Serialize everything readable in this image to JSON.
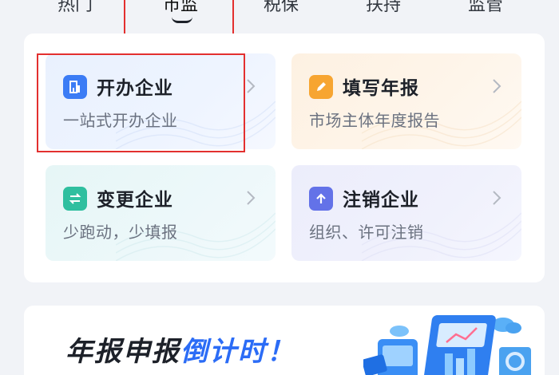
{
  "tabs": [
    {
      "label": "热门"
    },
    {
      "label": "市监"
    },
    {
      "label": "税保"
    },
    {
      "label": "扶持"
    },
    {
      "label": "监管"
    }
  ],
  "services": [
    {
      "title": "开办企业",
      "subtitle": "一站式开办企业",
      "icon": "building-icon",
      "color": "#3b7cf5"
    },
    {
      "title": "填写年报",
      "subtitle": "市场主体年度报告",
      "icon": "pencil-icon",
      "color": "#f7a531"
    },
    {
      "title": "变更企业",
      "subtitle": "少跑动，少填报",
      "icon": "swap-icon",
      "color": "#2fbf9f"
    },
    {
      "title": "注销企业",
      "subtitle": "组织、许可注销",
      "icon": "upload-arrow-icon",
      "color": "#6372e8"
    }
  ],
  "banner": {
    "title_dark": "年报申报",
    "title_blue": "倒计时！"
  },
  "colors": {
    "highlight": "#e3302f",
    "accent": "#2b6cf6"
  }
}
